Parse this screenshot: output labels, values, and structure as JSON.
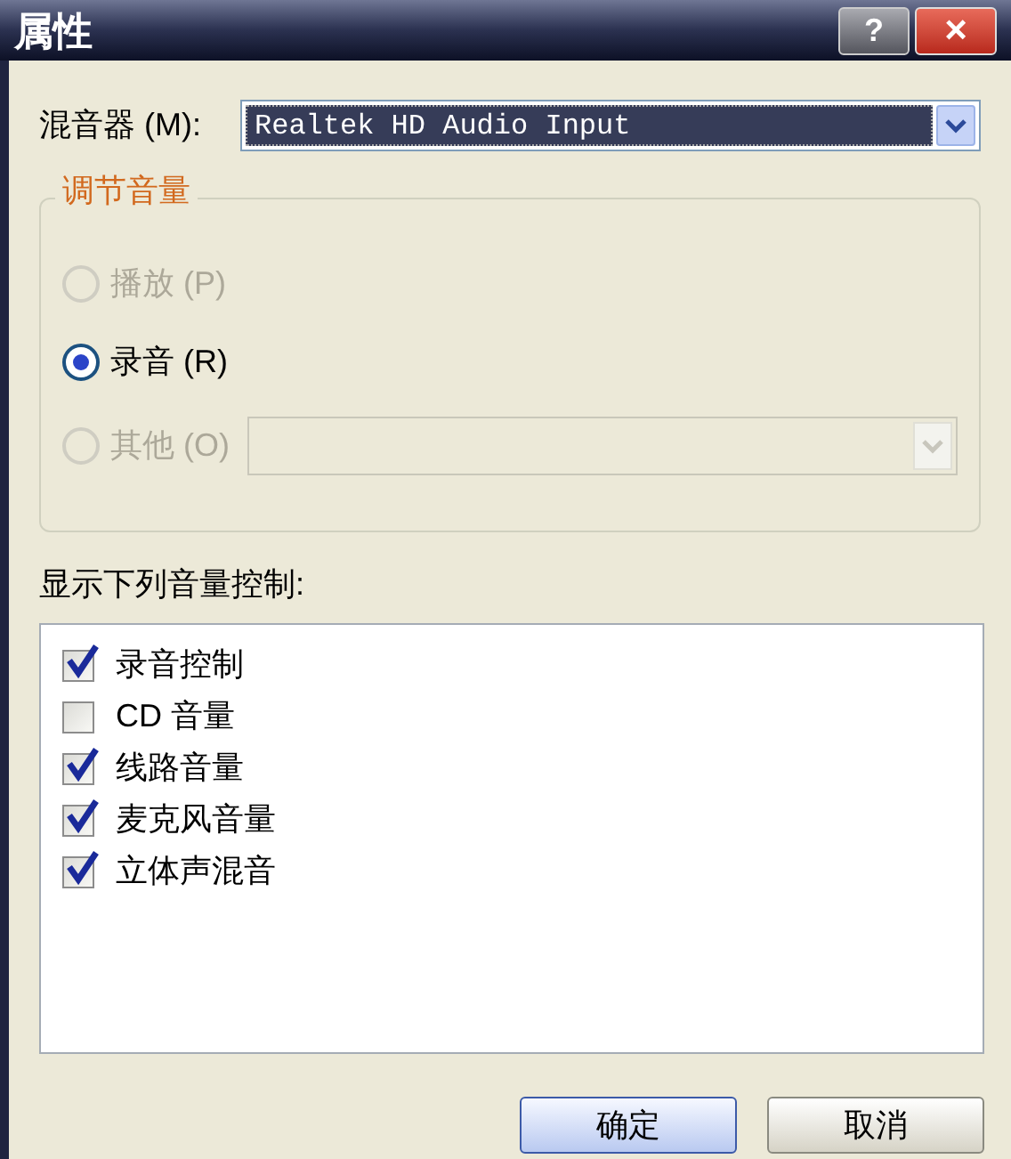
{
  "window": {
    "title": "属性",
    "help": "?",
    "close": "×"
  },
  "mixer": {
    "label": "混音器 (M):",
    "value": "Realtek HD Audio Input"
  },
  "volume_group": {
    "title": "调节音量",
    "options": [
      {
        "kind": "plain",
        "label": "播放 (P)",
        "selected": false,
        "disabled": true
      },
      {
        "kind": "plain",
        "label": "录音 (R)",
        "selected": true,
        "disabled": false
      },
      {
        "kind": "with-dropdown",
        "label": "其他 (O)",
        "selected": false,
        "disabled": true
      }
    ]
  },
  "controls": {
    "label": "显示下列音量控制:",
    "items": [
      {
        "label": "录音控制",
        "checked": true
      },
      {
        "label": "CD 音量",
        "checked": false
      },
      {
        "label": "线路音量",
        "checked": true
      },
      {
        "label": "麦克风音量",
        "checked": true
      },
      {
        "label": "立体声混音",
        "checked": true
      }
    ]
  },
  "buttons": [
    {
      "label": "确定",
      "default": true
    },
    {
      "label": "取消",
      "default": false
    }
  ]
}
